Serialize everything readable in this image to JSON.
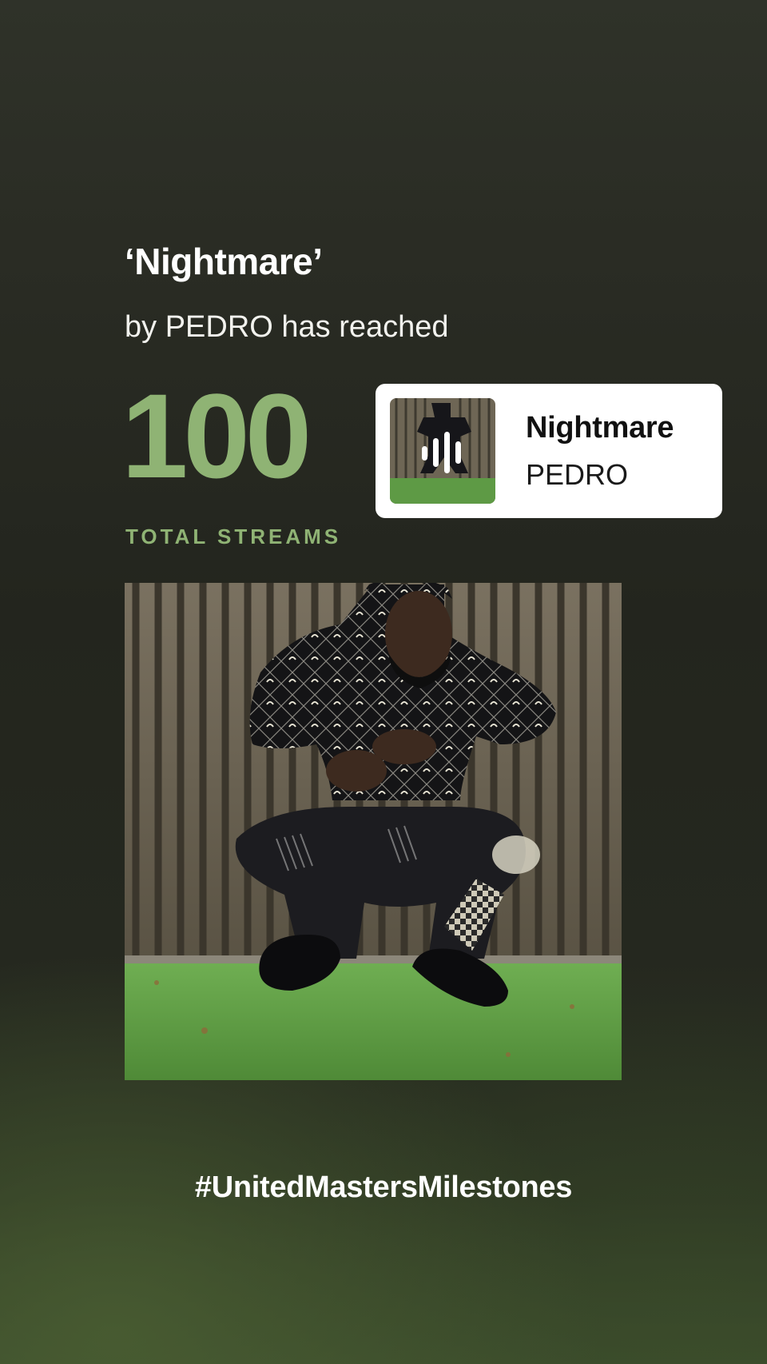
{
  "milestone": {
    "song_title": "‘Nightmare’",
    "subtitle": "by PEDRO has reached",
    "count": "100",
    "count_label": "TOTAL STREAMS",
    "hashtag": "#UnitedMastersMilestones"
  },
  "track_card": {
    "name": "Nightmare",
    "artist": "PEDRO",
    "overlay_icon": "audio-waveform-icon"
  },
  "colors": {
    "accent_green": "#8fb374",
    "card_bg": "#ffffff",
    "background": "#25281f"
  }
}
